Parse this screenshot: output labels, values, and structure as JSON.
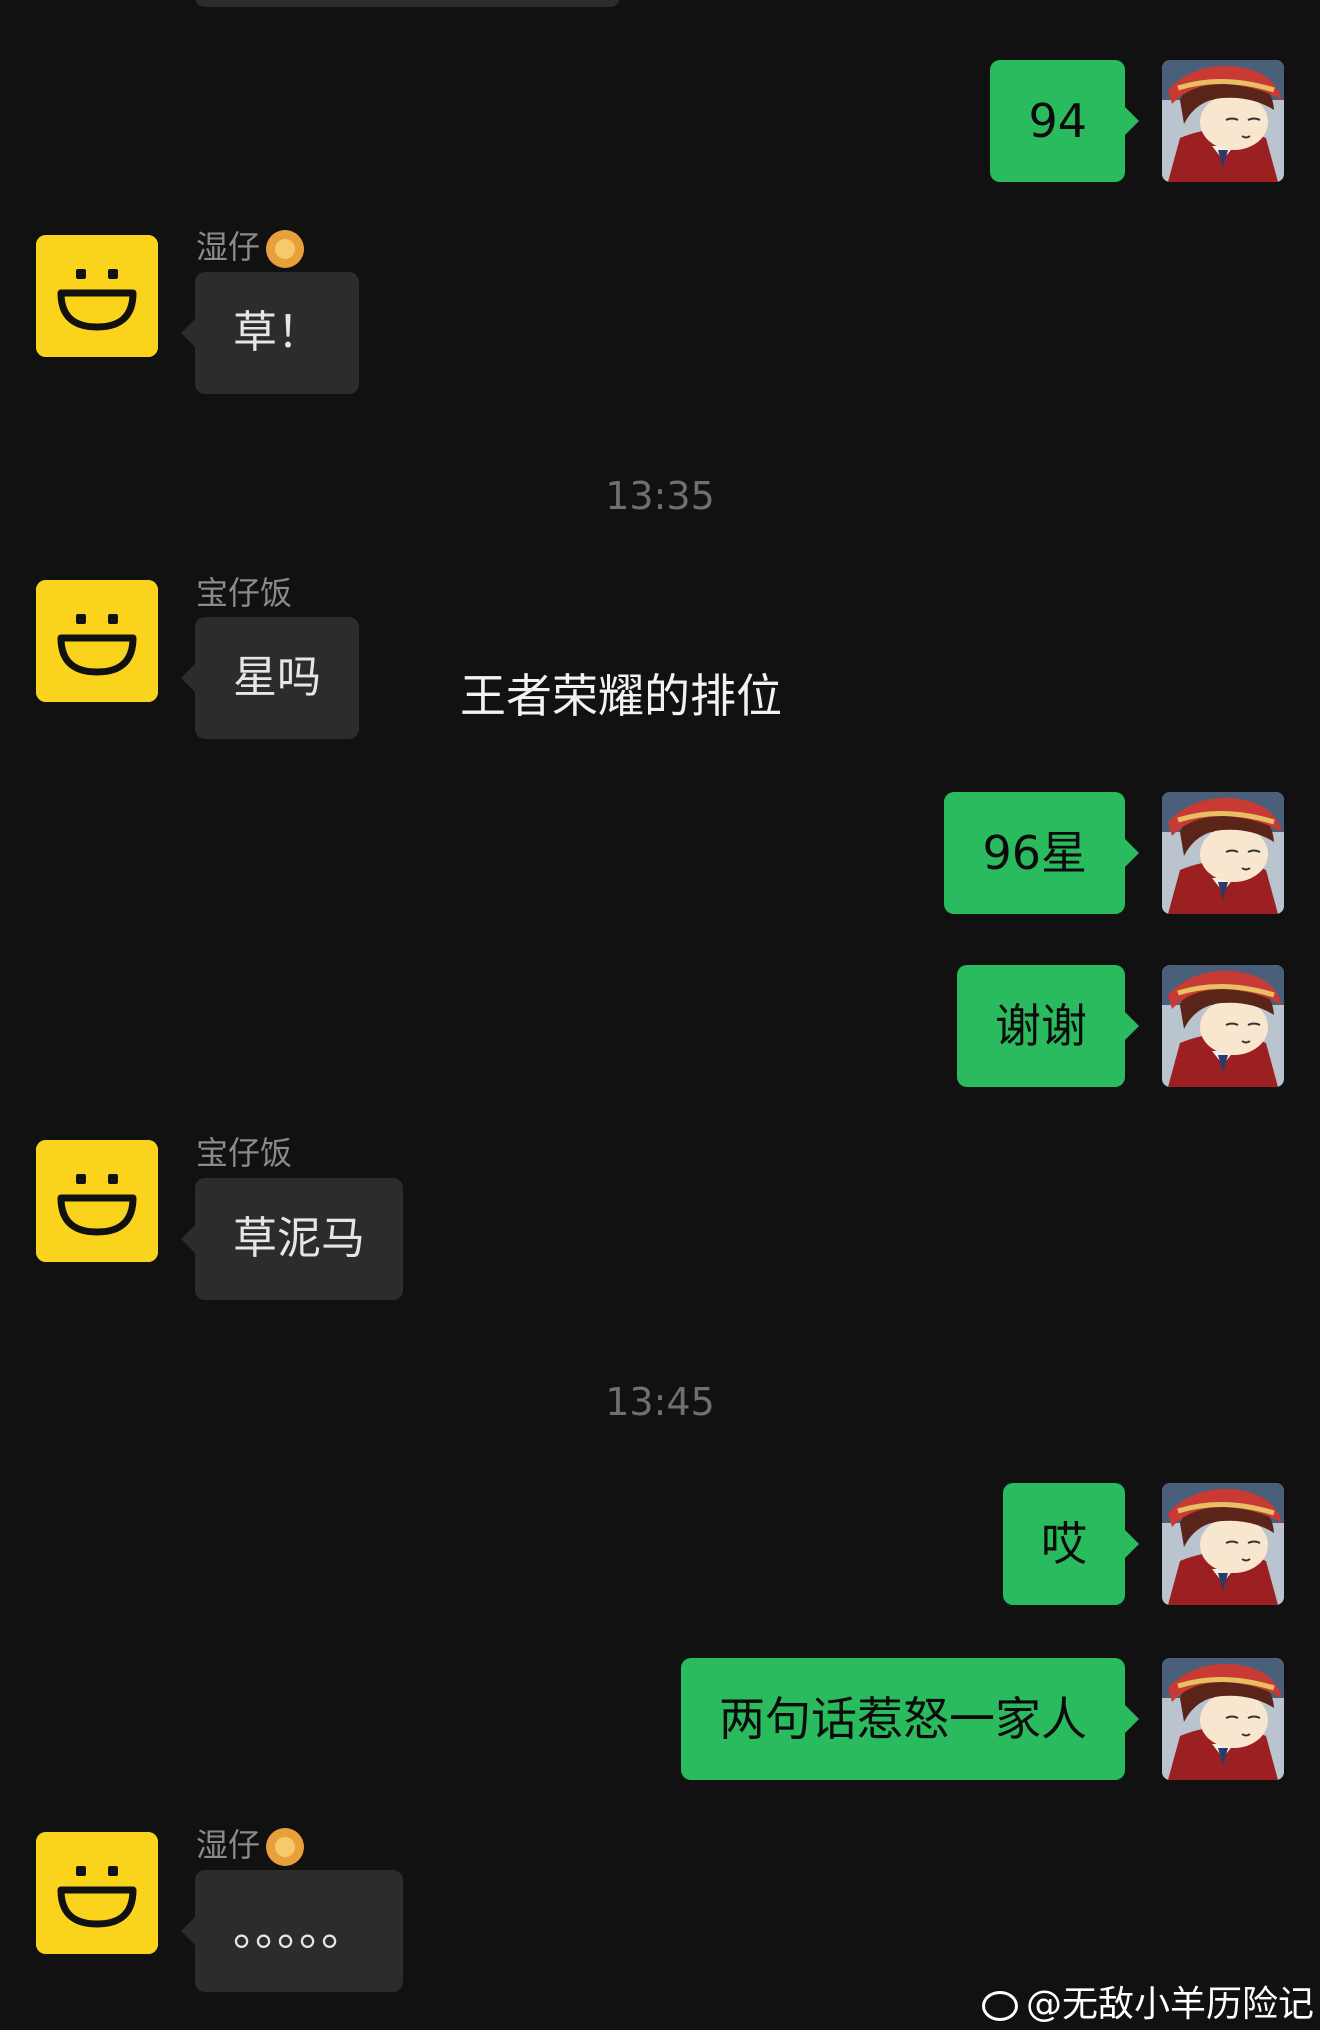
{
  "messages": [
    {
      "side": "out",
      "text": "94"
    },
    {
      "side": "in",
      "sender": "湿仔",
      "text": "草！"
    },
    {
      "side": "in",
      "sender": "宝仔饭",
      "text": "星吗"
    },
    {
      "side": "out",
      "text": "96星"
    },
    {
      "side": "out",
      "text": "谢谢"
    },
    {
      "side": "in",
      "sender": "宝仔饭",
      "text": "草泥马"
    },
    {
      "side": "out",
      "text": "哎"
    },
    {
      "side": "out",
      "text": "两句话惹怒一家人"
    },
    {
      "side": "in",
      "sender": "湿仔",
      "text": "。。。。。"
    }
  ],
  "timestamps": [
    "13:35",
    "13:45"
  ],
  "caption": "王者荣耀的排位",
  "watermark": "@无敌小羊历险记",
  "colors": {
    "background": "#111111",
    "incoming_bubble": "#2c2c2c",
    "outgoing_bubble": "#2bbb5f",
    "smiley_avatar": "#f9d31c"
  },
  "icons": {
    "sender_emoji": "lion-face-icon",
    "watermark_logo": "weibo-icon"
  }
}
